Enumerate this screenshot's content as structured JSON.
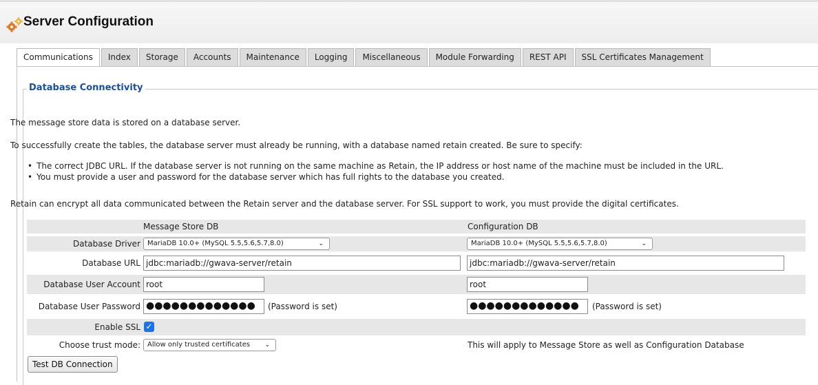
{
  "header": {
    "title": "Server Configuration",
    "icon": "gears-icon"
  },
  "tabs": [
    {
      "label": "Communications",
      "active": true
    },
    {
      "label": "Index",
      "active": false
    },
    {
      "label": "Storage",
      "active": false
    },
    {
      "label": "Accounts",
      "active": false
    },
    {
      "label": "Maintenance",
      "active": false
    },
    {
      "label": "Logging",
      "active": false
    },
    {
      "label": "Miscellaneous",
      "active": false
    },
    {
      "label": "Module Forwarding",
      "active": false
    },
    {
      "label": "REST API",
      "active": false
    },
    {
      "label": "SSL Certificates Management",
      "active": false
    }
  ],
  "section": {
    "legend": "Database Connectivity",
    "intro": "The message store data is stored on a database server.",
    "instructions": "To successfully create the tables, the database server must already be running, with a database named retain created. Be sure to specify:",
    "bullets": [
      "The correct JDBC URL. If the database server is not running on the same machine as Retain, the IP address or host name of the machine must be included in the URL.",
      "You must provide a user and password for the database server which has full rights to the database you created."
    ],
    "encrypt_note": "Retain can encrypt all data communicated between the Retain server and the database server. For SSL support to work, you must provide the digital certificates."
  },
  "form": {
    "col_message_store": "Message Store DB",
    "col_configuration": "Configuration DB",
    "driver_label": "Database Driver",
    "url_label": "Database URL",
    "user_label": "Database User Account",
    "password_label": "Database User Password",
    "ssl_label": "Enable SSL",
    "trust_label": "Choose trust mode:",
    "ms_driver": "MariaDB 10.0+ (MySQL 5.5,5.6,5.7,8.0)",
    "cfg_driver": "MariaDB 10.0+ (MySQL 5.5,5.6,5.7,8.0)",
    "ms_url": "jdbc:mariadb://gwava-server/retain",
    "cfg_url": "jdbc:mariadb://gwava-server/retain",
    "ms_user": "root",
    "cfg_user": "root",
    "ms_password_mask": "●●●●●●●●●●●●●",
    "cfg_password_mask": "●●●●●●●●●●●●●",
    "ms_password_status": "(Password is set)",
    "cfg_password_status": "(Password is set)",
    "ssl_enabled": true,
    "trust_mode": "Allow only trusted certificates",
    "trust_note": "This will apply to Message Store as well as Configuration Database",
    "test_button": "Test DB Connection"
  },
  "colors": {
    "legend": "#1b4f9a",
    "checkbox": "#1a73e8",
    "row_shade": "#e7e7e7"
  }
}
